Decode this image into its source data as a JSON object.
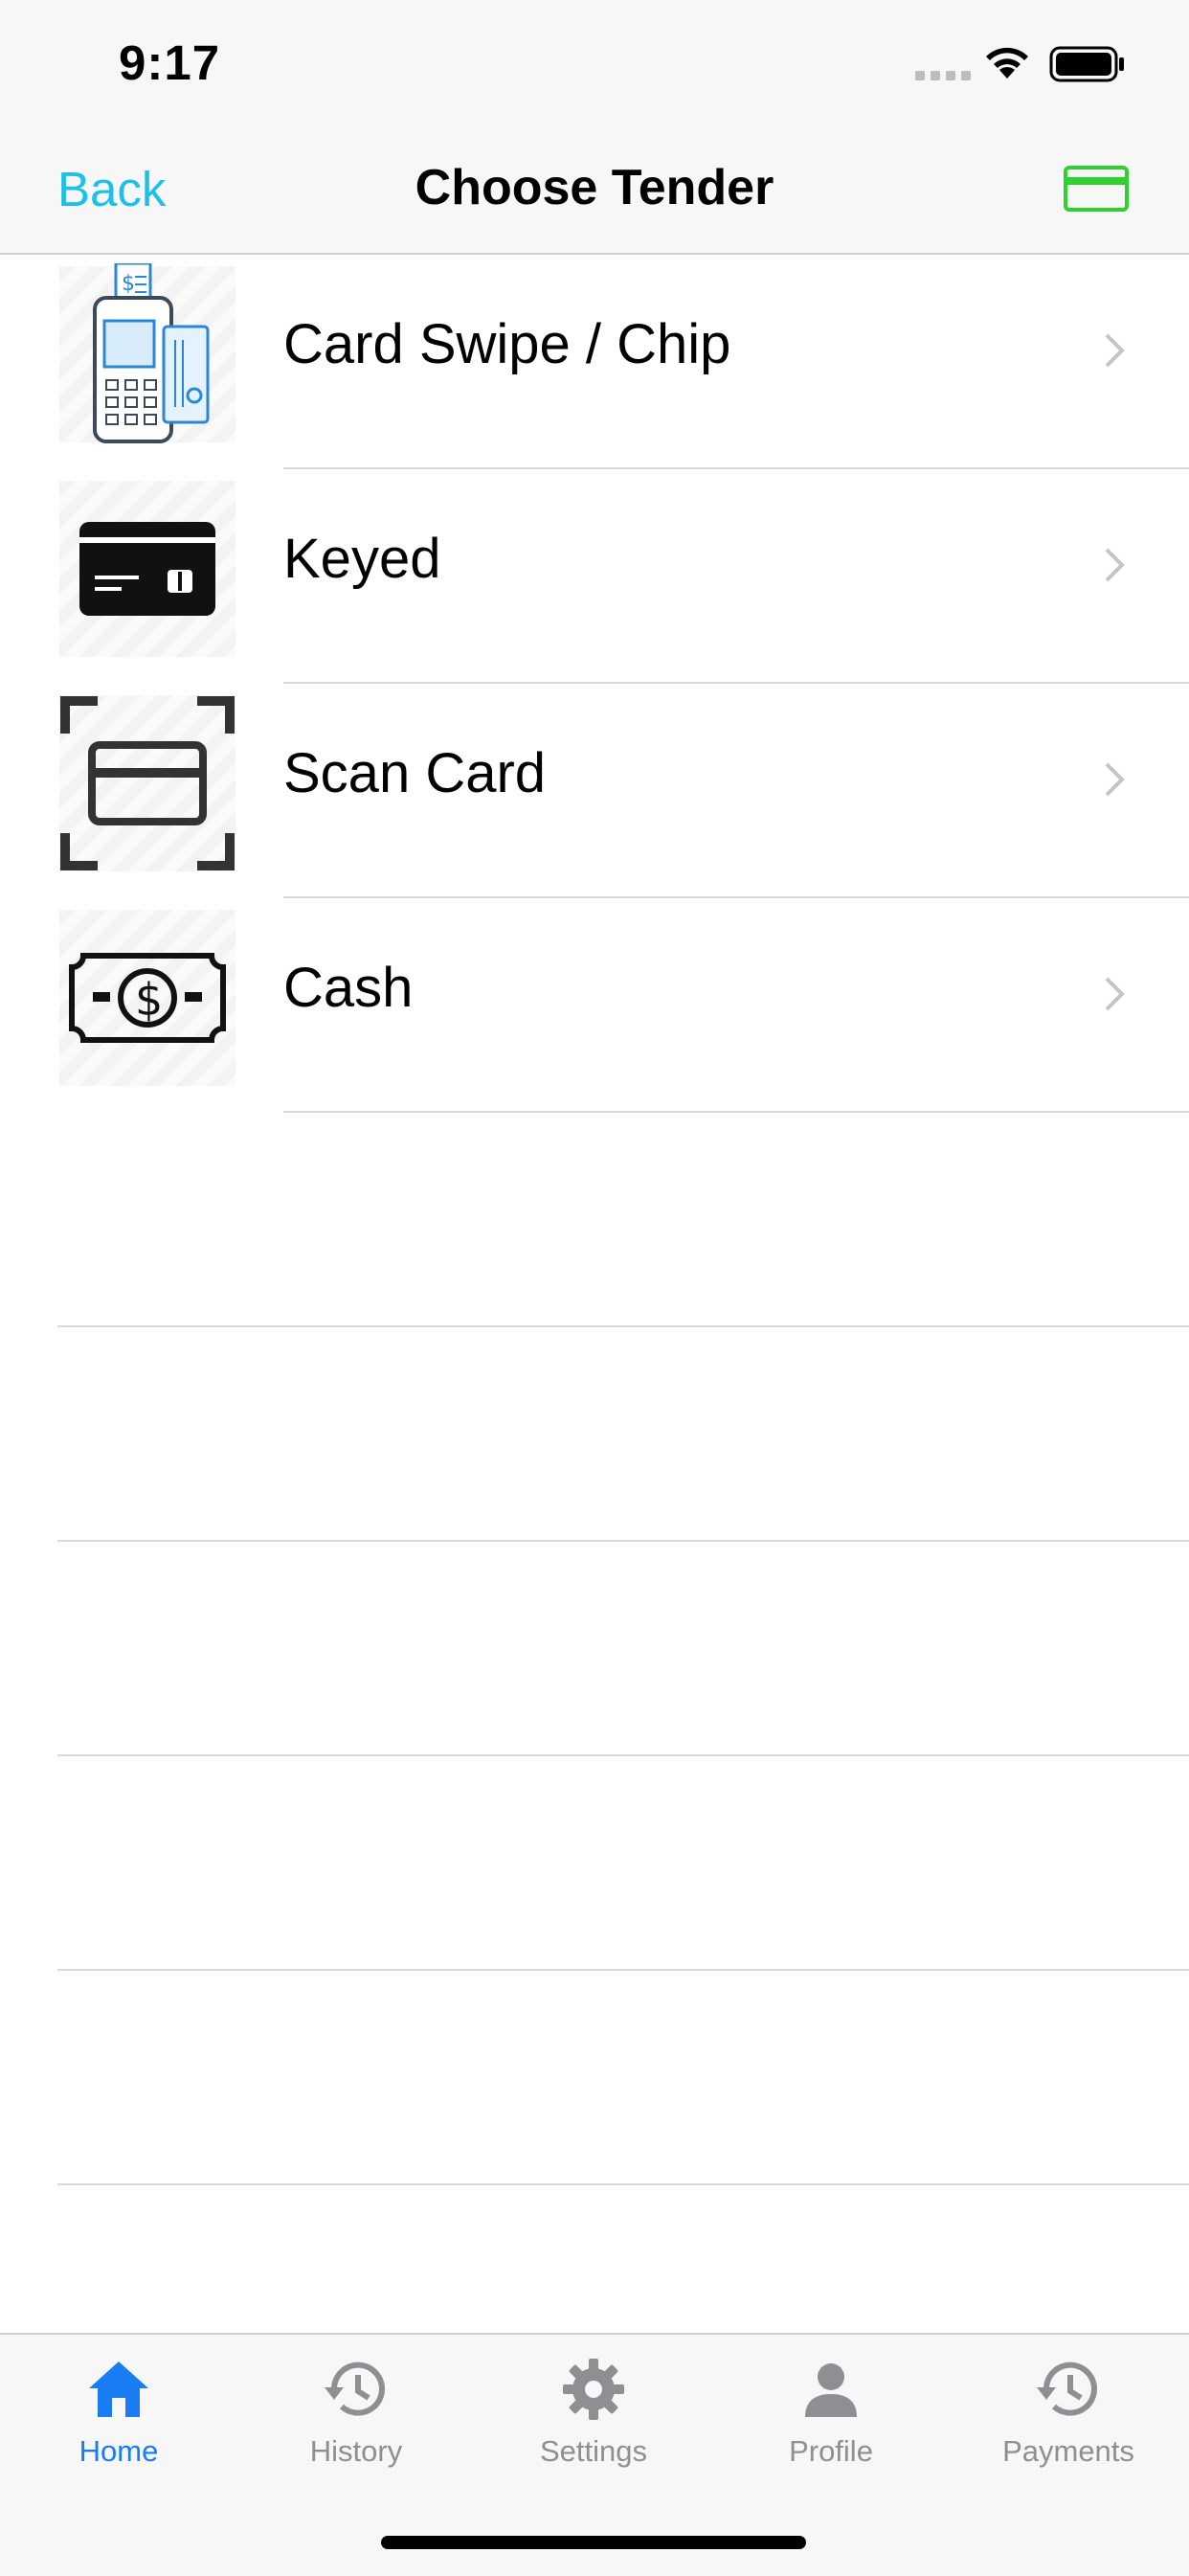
{
  "status_bar": {
    "time": "9:17"
  },
  "nav": {
    "back_label": "Back",
    "title": "Choose Tender",
    "accent": "#1ec1e6",
    "card_icon_color": "#2fd12f"
  },
  "tenders": [
    {
      "label": "Card Swipe / Chip",
      "icon": "card-terminal-icon"
    },
    {
      "label": "Keyed",
      "icon": "credit-card-icon"
    },
    {
      "label": "Scan Card",
      "icon": "scan-card-icon"
    },
    {
      "label": "Cash",
      "icon": "cash-icon"
    }
  ],
  "tab_bar": {
    "active_color": "#1a7cf2",
    "items": [
      {
        "label": "Home",
        "icon": "home-icon",
        "active": true
      },
      {
        "label": "History",
        "icon": "history-icon",
        "active": false
      },
      {
        "label": "Settings",
        "icon": "gear-icon",
        "active": false
      },
      {
        "label": "Profile",
        "icon": "person-icon",
        "active": false
      },
      {
        "label": "Payments",
        "icon": "history-icon",
        "active": false
      }
    ]
  }
}
